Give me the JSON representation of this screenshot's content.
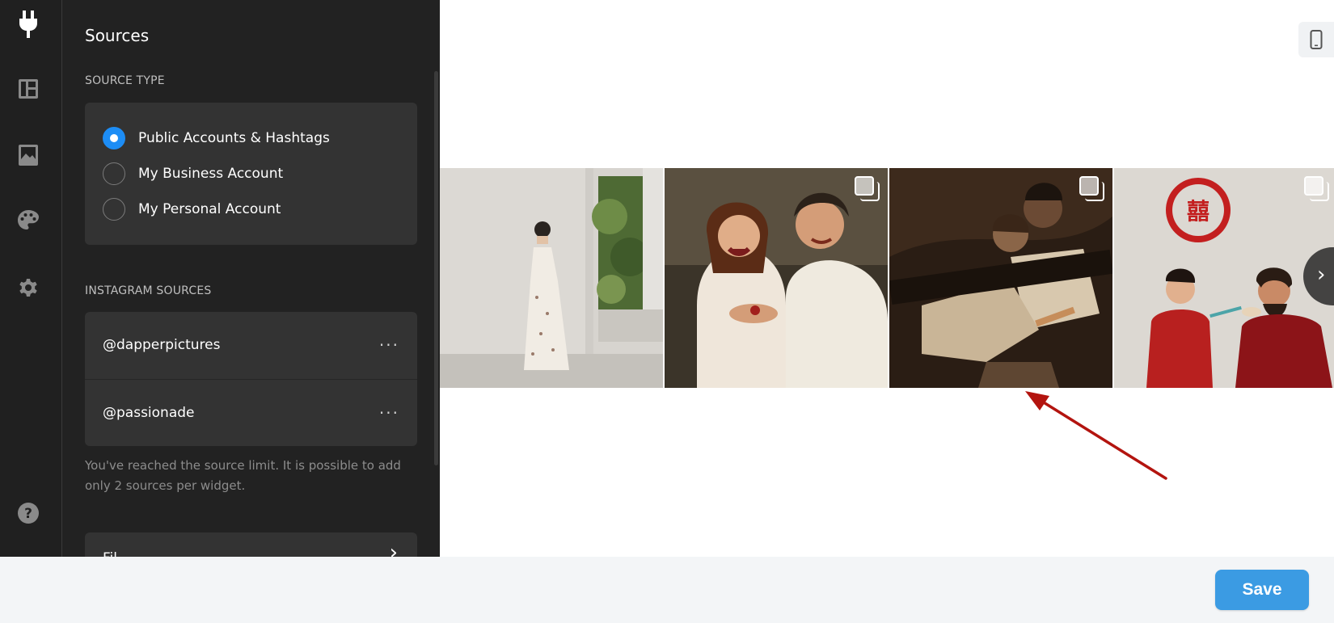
{
  "rail": {
    "items": [
      {
        "icon": "plug-icon",
        "active": true
      },
      {
        "icon": "layout-icon",
        "active": false
      },
      {
        "icon": "image-icon",
        "active": false
      },
      {
        "icon": "palette-icon",
        "active": false
      },
      {
        "icon": "gear-icon",
        "active": false
      },
      {
        "icon": "help-icon",
        "active": false
      }
    ]
  },
  "panel": {
    "title": "Sources",
    "source_type_label": "SOURCE TYPE",
    "source_types": [
      {
        "label": "Public Accounts & Hashtags",
        "checked": true
      },
      {
        "label": "My Business Account",
        "checked": false
      },
      {
        "label": "My Personal Account",
        "checked": false
      }
    ],
    "instagram_sources_label": "INSTAGRAM SOURCES",
    "sources": [
      {
        "label": "@dapperpictures",
        "menu": "···"
      },
      {
        "label": "@passionade",
        "menu": "···"
      }
    ],
    "limit_note": "You've reached the source limit. It is possible to add only 2 sources per widget.",
    "next_card_label": "Fil",
    "next_card_chevron": "›"
  },
  "preview": {
    "device_icon": "mobile-icon",
    "next_arrow": "›",
    "tiles": [
      {
        "name": "photo-woman-floral-dress",
        "multi": false
      },
      {
        "name": "photo-couple-laughing",
        "multi": true
      },
      {
        "name": "photo-couple-kissing",
        "multi": true
      },
      {
        "name": "photo-wedding-tea-ceremony",
        "multi": true
      }
    ],
    "annotation_color": "#b3140f"
  },
  "footer": {
    "save_label": "Save",
    "save_color": "#3b9be3"
  }
}
